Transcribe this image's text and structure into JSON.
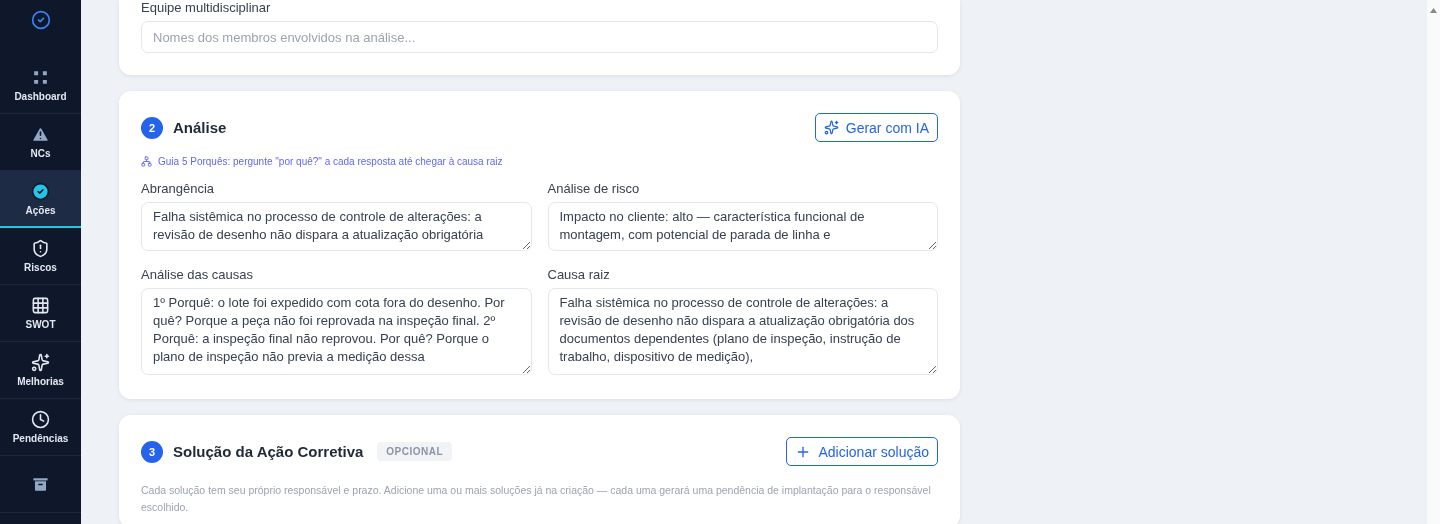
{
  "sidebar": {
    "items": [
      {
        "kind": "grid",
        "label": "Dashboard",
        "selected": false
      },
      {
        "kind": "alert",
        "label": "NCs",
        "selected": false
      },
      {
        "kind": "check",
        "label": "Ações",
        "selected": true
      },
      {
        "kind": "shield",
        "label": "Riscos",
        "selected": false
      },
      {
        "kind": "dots",
        "label": "SWOT",
        "selected": false
      },
      {
        "kind": "sparkles",
        "label": "Melhorias",
        "selected": false
      },
      {
        "kind": "clock",
        "label": "Pendências",
        "selected": false
      },
      {
        "kind": "archive",
        "selected": false
      }
    ]
  },
  "team_card": {
    "label": "Equipe multidisciplinar",
    "placeholder": "Nomes dos membros envolvidos na análise..."
  },
  "analysis_card": {
    "number": "2",
    "title": "Análise",
    "button": "Gerar com IA",
    "guide": "Guia 5 Porquês: pergunte \"por quê?\" a cada resposta até chegar à causa raiz",
    "fields": [
      {
        "label": "Abrangência",
        "value": "Falha sistêmica no processo de controle de alterações: a revisão de desenho não dispara a atualização obrigatória"
      },
      {
        "label": "Análise de risco",
        "value": "Impacto no cliente: alto — característica funcional de montagem, com potencial de parada de linha e"
      },
      {
        "label": "Análise das causas",
        "value": "1º Porquê: o lote foi expedido com cota fora do desenho. Por quê? Porque a peça não foi reprovada na inspeção final. 2º Porquê: a inspeção final não reprovou. Por quê? Porque o plano de inspeção não previa a medição dessa"
      },
      {
        "label": "Causa raiz",
        "value": "Falha sistêmica no processo de controle de alterações: a revisão de desenho não dispara a atualização obrigatória dos documentos dependentes (plano de inspeção, instrução de trabalho, dispositivo de medição),"
      }
    ]
  },
  "solution_card": {
    "number": "3",
    "title": "Solução da Ação Corretiva",
    "badge": "OPCIONAL",
    "button": "Adicionar solução",
    "description": "Cada solução tem seu próprio responsável e prazo. Adicione uma ou mais soluções já na criação — cada uma gerará uma pendência de implantação para o responsável escolhido."
  }
}
